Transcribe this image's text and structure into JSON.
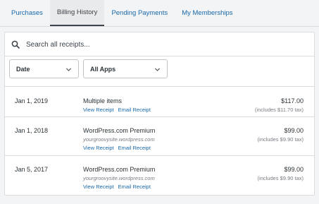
{
  "tabs": [
    {
      "label": "Purchases"
    },
    {
      "label": "Billing History"
    },
    {
      "label": "Pending Payments"
    },
    {
      "label": "My Memberships"
    }
  ],
  "active_tab": "Billing History",
  "search": {
    "placeholder": "Search all receipts...",
    "value": ""
  },
  "filters": {
    "date_label": "Date",
    "apps_label": "All Apps"
  },
  "receipts": [
    {
      "date": "Jan 1, 2019",
      "title": "Multiple items",
      "site": "",
      "view_label": "View Receipt",
      "email_label": "Email Receipt",
      "amount": "$117.00",
      "tax": "(includes $11.70 tax)"
    },
    {
      "date": "Jan 1, 2018",
      "title": "WordPress.com Premium",
      "site": "yourgroovysite.wordpress.com",
      "view_label": "View Receipt",
      "email_label": "Email Receipt",
      "amount": "$99.00",
      "tax": "(includes $9.90 tax)"
    },
    {
      "date": "Jan 5, 2017",
      "title": "WordPress.com Premium",
      "site": "yourgroovysite.wordpress.com",
      "view_label": "View Receipt",
      "email_label": "Email Receipt",
      "amount": "$99.00",
      "tax": "(includes $9.90 tax)"
    }
  ],
  "colors": {
    "link": "#1968a8",
    "text": "#2c3338",
    "muted": "#787c82",
    "border": "#dcdcde",
    "background": "#f3f4f5"
  }
}
